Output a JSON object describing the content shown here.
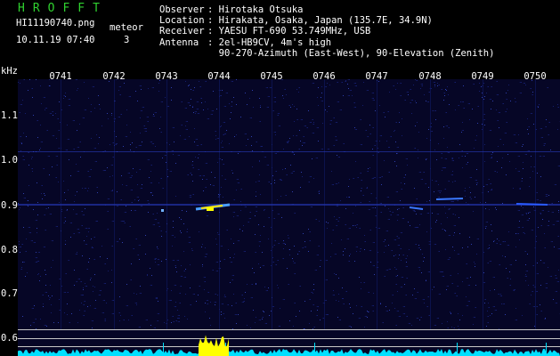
{
  "logo": "HROFFT",
  "file_name": "HI11190740.png",
  "meteor_label": "meteor",
  "meteor_count": "3",
  "datetime": "10.11.19 07:40",
  "info": [
    {
      "key": "Observer",
      "value": "Hirotaka Otsuka"
    },
    {
      "key": "Location",
      "value": "Hirakata, Osaka, Japan (135.7E, 34.9N)"
    },
    {
      "key": "Receiver",
      "value": "YAESU FT-690 53.749MHz, USB"
    },
    {
      "key": "Antenna",
      "value": "2el-HB9CV, 4m's high"
    },
    {
      "key": "",
      "value": "90-270-Azimuth (East-West), 90-Elevation (Zenith)"
    }
  ],
  "freq_unit": "kHz",
  "time_labels": [
    "0741",
    "0742",
    "0743",
    "0744",
    "0745",
    "0746",
    "0747",
    "0748",
    "0749",
    "0750"
  ],
  "freq_labels": [
    "1.1",
    "1.0",
    "0.9",
    "0.8",
    "0.7",
    "0.6"
  ],
  "colors": {
    "background": "#000000",
    "spectrogram_bg": "#060626",
    "logo": "#2fd12f",
    "meteor_echo": "#ffe000",
    "noise_floor": "#00e0ff",
    "strong_echo": "#ffff00",
    "guide_line": "#c8c8c8"
  }
}
